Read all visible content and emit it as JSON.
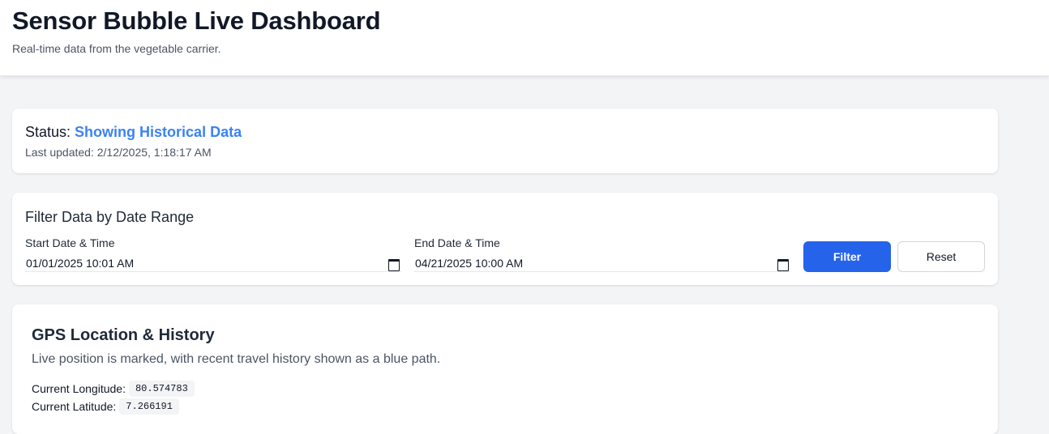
{
  "header": {
    "title": "Sensor Bubble Live Dashboard",
    "subtitle": "Real-time data from the vegetable carrier."
  },
  "status": {
    "label": "Status:",
    "value": "Showing Historical Data",
    "value_color": "#3b82f6",
    "last_updated": "Last updated: 2/12/2025, 1:18:17 AM"
  },
  "filter": {
    "title": "Filter Data by Date Range",
    "start_label": "Start Date & Time",
    "start_value": "01/01/2025 10:01 AM",
    "end_label": "End Date & Time",
    "end_value": "04/21/2025 10:00 AM",
    "filter_button": "Filter",
    "reset_button": "Reset",
    "accent": "#2563eb",
    "icon": "calendar-icon"
  },
  "gps": {
    "title": "GPS Location & History",
    "description": "Live position is marked, with recent travel history shown as a blue path.",
    "longitude_label": "Current Longitude:",
    "longitude_value": "80.574783",
    "latitude_label": "Current Latitude:",
    "latitude_value": "7.266191"
  }
}
